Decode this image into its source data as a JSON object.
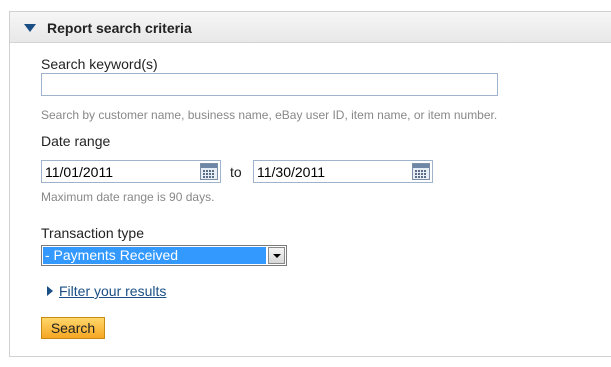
{
  "panel": {
    "title": "Report search criteria",
    "collapse_icon": "triangle-down-icon"
  },
  "keyword": {
    "label": "Search keyword(s)",
    "value": "",
    "hint": "Search by customer name, business name, eBay user ID, item name, or item number."
  },
  "date_range": {
    "label": "Date range",
    "from": "11/01/2011",
    "separator": "to",
    "to": "11/30/2011",
    "hint": "Maximum date range is 90 days.",
    "calendar_icon": "calendar-icon"
  },
  "transaction_type": {
    "label": "Transaction type",
    "selected": "- Payments Received",
    "dropdown_icon": "chevron-down-icon"
  },
  "filter": {
    "label": "Filter your results",
    "icon": "triangle-right-icon"
  },
  "actions": {
    "search_label": "Search"
  },
  "colors": {
    "link": "#1a4f86",
    "selected_highlight": "#3399ff",
    "button": "#f5a623"
  }
}
